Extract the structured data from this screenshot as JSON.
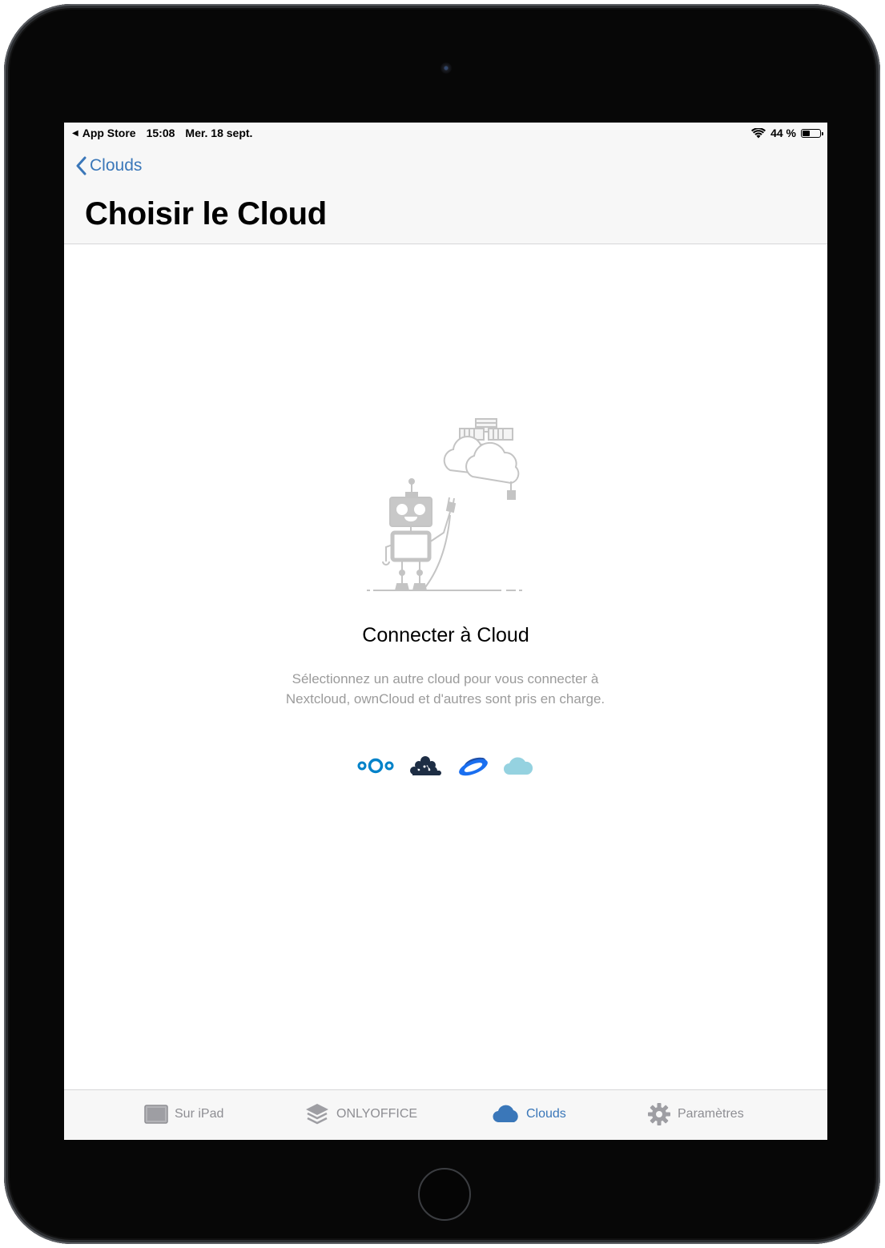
{
  "status_bar": {
    "back_app": "App Store",
    "time": "15:08",
    "date": "Mer. 18 sept.",
    "battery_text": "44 %",
    "battery_level": 0.44
  },
  "nav": {
    "back_label": "Clouds",
    "title": "Choisir le Cloud"
  },
  "empty_state": {
    "title": "Connecter à Cloud",
    "description": "Sélectionnez un autre cloud pour vous connecter à Nextcloud, ownCloud et d'autres sont pris en charge.",
    "illustration_icon": "robot-plugging-into-cloud-illustration",
    "providers": [
      {
        "name": "nextcloud-logo-icon",
        "color": "#0082c9"
      },
      {
        "name": "owncloud-logo-icon",
        "color": "#1d2d44"
      },
      {
        "name": "yandex-disk-logo-icon",
        "color": "#1a6ff0"
      },
      {
        "name": "generic-cloud-logo-icon",
        "color": "#95d2e0"
      }
    ]
  },
  "tab_bar": {
    "tabs": [
      {
        "label": "Sur iPad",
        "icon": "ipad-icon",
        "active": false
      },
      {
        "label": "ONLYOFFICE",
        "icon": "layers-icon",
        "active": false
      },
      {
        "label": "Clouds",
        "icon": "cloud-icon",
        "active": true
      },
      {
        "label": "Paramètres",
        "icon": "gear-icon",
        "active": false
      }
    ]
  },
  "colors": {
    "accent": "#3a77b9",
    "inactive": "#8e8e93",
    "bar_background": "#f7f7f7"
  }
}
